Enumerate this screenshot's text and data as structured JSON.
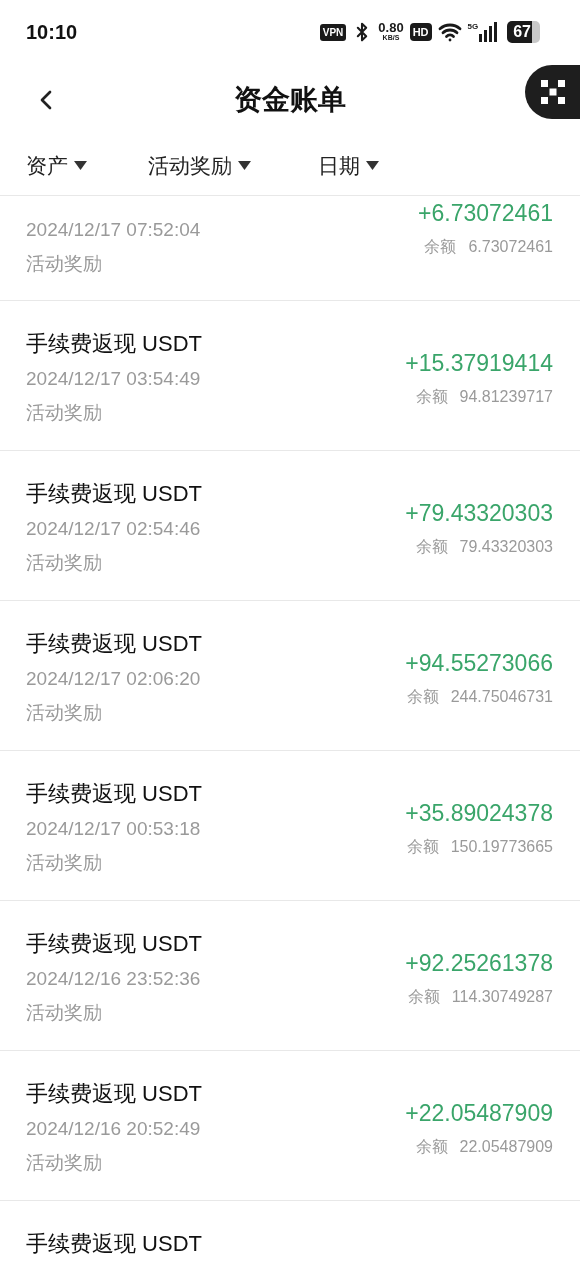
{
  "status_bar": {
    "time": "10:10",
    "vpn": "VPN",
    "speed": "0.80",
    "speed_unit": "KB/S",
    "hd": "HD",
    "network": "5G",
    "battery": "67"
  },
  "header": {
    "title": "资金账单"
  },
  "filters": [
    {
      "label": "资产"
    },
    {
      "label": "活动奖励"
    },
    {
      "label": "日期"
    }
  ],
  "records": [
    {
      "date": "2024/12/17 07:52:04",
      "category": "活动奖励",
      "amount": "+6.73072461",
      "balance_label": "余额",
      "balance": "6.73072461"
    },
    {
      "title": "手续费返现 USDT",
      "date": "2024/12/17 03:54:49",
      "category": "活动奖励",
      "amount": "+15.37919414",
      "balance_label": "余额",
      "balance": "94.81239717"
    },
    {
      "title": "手续费返现 USDT",
      "date": "2024/12/17 02:54:46",
      "category": "活动奖励",
      "amount": "+79.43320303",
      "balance_label": "余额",
      "balance": "79.43320303"
    },
    {
      "title": "手续费返现 USDT",
      "date": "2024/12/17 02:06:20",
      "category": "活动奖励",
      "amount": "+94.55273066",
      "balance_label": "余额",
      "balance": "244.75046731"
    },
    {
      "title": "手续费返现 USDT",
      "date": "2024/12/17 00:53:18",
      "category": "活动奖励",
      "amount": "+35.89024378",
      "balance_label": "余额",
      "balance": "150.19773665"
    },
    {
      "title": "手续费返现 USDT",
      "date": "2024/12/16 23:52:36",
      "category": "活动奖励",
      "amount": "+92.25261378",
      "balance_label": "余额",
      "balance": "114.30749287"
    },
    {
      "title": "手续费返现 USDT",
      "date": "2024/12/16 20:52:49",
      "category": "活动奖励",
      "amount": "+22.05487909",
      "balance_label": "余额",
      "balance": "22.05487909"
    },
    {
      "title": "手续费返现 USDT"
    }
  ]
}
